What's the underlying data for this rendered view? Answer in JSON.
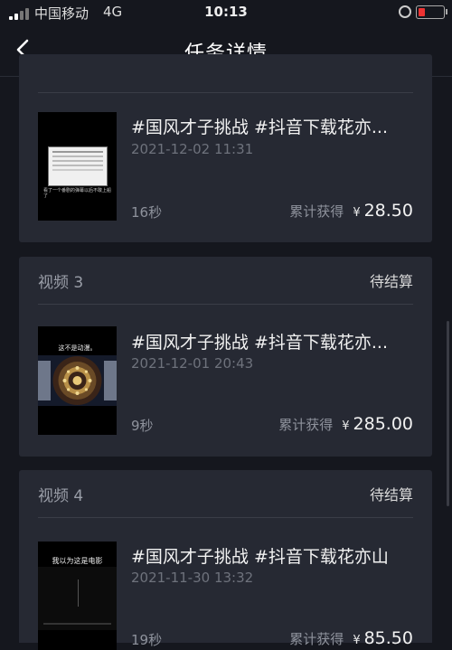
{
  "status_bar": {
    "carrier": "中国移动",
    "network": "4G",
    "time": "10:13"
  },
  "header": {
    "title": "任务详情"
  },
  "videos": [
    {
      "label": "",
      "status": "",
      "title": "#国风才子挑战 #抖音下载花亦...",
      "date": "2021-12-02 11:31",
      "duration": "16秒",
      "earn_label": "累计获得",
      "currency": "¥",
      "amount": "28.50",
      "thumb_caption": "看了一个番剧的弹幕以后不敢上船了"
    },
    {
      "label": "视频 3",
      "status": "待结算",
      "title": "#国风才子挑战 #抖音下载花亦...",
      "date": "2021-12-01 20:43",
      "duration": "9秒",
      "earn_label": "累计获得",
      "currency": "¥",
      "amount": "285.00",
      "thumb_caption": "这不是动漫。"
    },
    {
      "label": "视频 4",
      "status": "待结算",
      "title": "#国风才子挑战 #抖音下载花亦山",
      "date": "2021-11-30 13:32",
      "duration": "19秒",
      "earn_label": "累计获得",
      "currency": "¥",
      "amount": "85.50",
      "thumb_caption": "我以为这是电影"
    }
  ],
  "colors": {
    "background": "#15171e",
    "card": "#262933",
    "text_primary": "#f2f2f2",
    "text_secondary": "#8e929c",
    "battery_low": "#e33333"
  },
  "icons": {
    "back": "chevron-left-icon",
    "alarm": "alarm-icon",
    "battery": "battery-icon",
    "signal": "signal-icon"
  }
}
